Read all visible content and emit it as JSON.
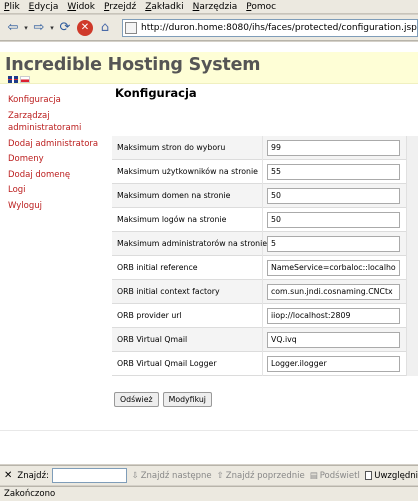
{
  "menubar": {
    "items": [
      "Plik",
      "Edycja",
      "Widok",
      "Przejdź",
      "Zakładki",
      "Narzędzia",
      "Pomoc"
    ]
  },
  "navbar": {
    "url": "http://duron.home:8080/ihs/faces/protected/configuration.jsp"
  },
  "banner": {
    "title": "Incredible Hosting System"
  },
  "sidebar": {
    "items": [
      "Konfiguracja",
      "Zarządzaj administratorami",
      "Dodaj administratora",
      "Domeny",
      "Dodaj domenę",
      "Logi",
      "Wyloguj"
    ]
  },
  "page": {
    "title": "Konfiguracja"
  },
  "config": {
    "rows": [
      {
        "label": "Maksimum stron do wyboru",
        "value": "99"
      },
      {
        "label": "Maksimum użytkowników na stronie",
        "value": "55"
      },
      {
        "label": "Maksimum domen na stronie",
        "value": "50"
      },
      {
        "label": "Maksimum logów na stronie",
        "value": "50"
      },
      {
        "label": "Maksimum administratorów na stronie",
        "value": "5"
      },
      {
        "label": "ORB initial reference",
        "value": "NameService=corbaloc::localho"
      },
      {
        "label": "ORB initial context factory",
        "value": "com.sun.jndi.cosnaming.CNCtx"
      },
      {
        "label": "ORB provider url",
        "value": "iiop://localhost:2809"
      },
      {
        "label": "ORB Virtual Qmail",
        "value": "VQ.ivq"
      },
      {
        "label": "ORB Virtual Qmail Logger",
        "value": "Logger.ilogger"
      }
    ]
  },
  "actions": {
    "refresh_label": "Odśwież",
    "modify_label": "Modyfikuj"
  },
  "findbar": {
    "label": "Znajdź:",
    "next_label": "Znajdź następne",
    "prev_label": "Znajdź poprzednie",
    "highlight_label": "Podświetl",
    "case_label": "Uwzględni"
  },
  "status": {
    "text": "Zakończono"
  }
}
